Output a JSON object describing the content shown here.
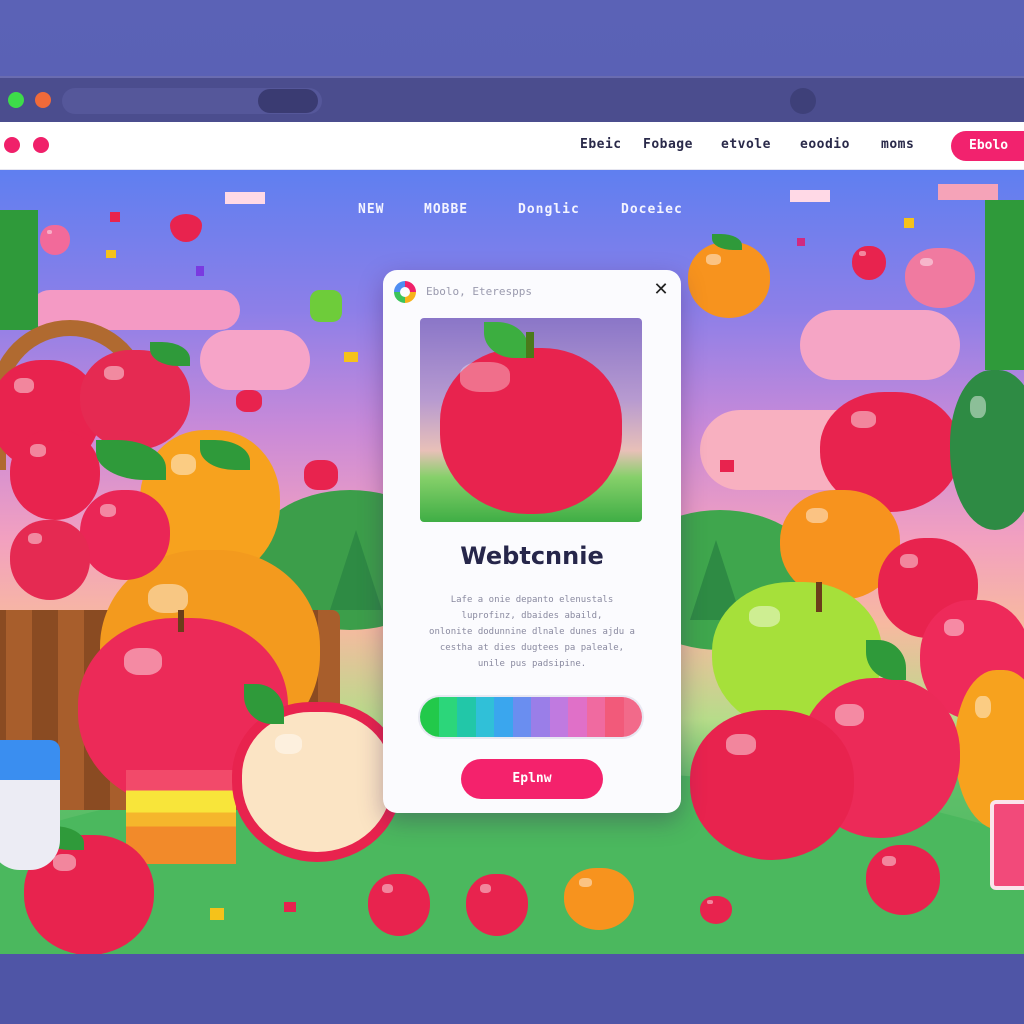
{
  "browser": {
    "controls": [
      "green-dot",
      "orange-dot"
    ]
  },
  "header": {
    "nav": [
      "Ebeic",
      "Fobage",
      "etvole",
      "eoodio",
      "moms"
    ],
    "cta_label": "Ebolo"
  },
  "sub_nav": [
    "NEW",
    "MOBBE",
    "Donglic",
    "Doceiec"
  ],
  "modal": {
    "small_title": "Ebolo, Eterespps",
    "close_label": "✕",
    "heading": "Webtcnnie",
    "body_lines": [
      "Lafe a onie depanto elenustals",
      "luprofinz, dbaides abaild,",
      "onlonite dodunnine dlnale dunes ajdu a",
      "cestha at dies dugtees pa paleale,",
      "unile pus padsipine."
    ],
    "palette": [
      "#22c94a",
      "#2cd67a",
      "#22c7a8",
      "#30c0d8",
      "#3aa6ee",
      "#6a8ef0",
      "#9a7ee8",
      "#c07ae0",
      "#e070c8",
      "#f06aa0",
      "#f25a7a",
      "#f26a8a"
    ],
    "button_label": "Eplnw"
  },
  "colors": {
    "accent": "#f2226e",
    "apple_red": "#e8234e",
    "orange": "#f7931e",
    "green_apple": "#a6e03a"
  }
}
